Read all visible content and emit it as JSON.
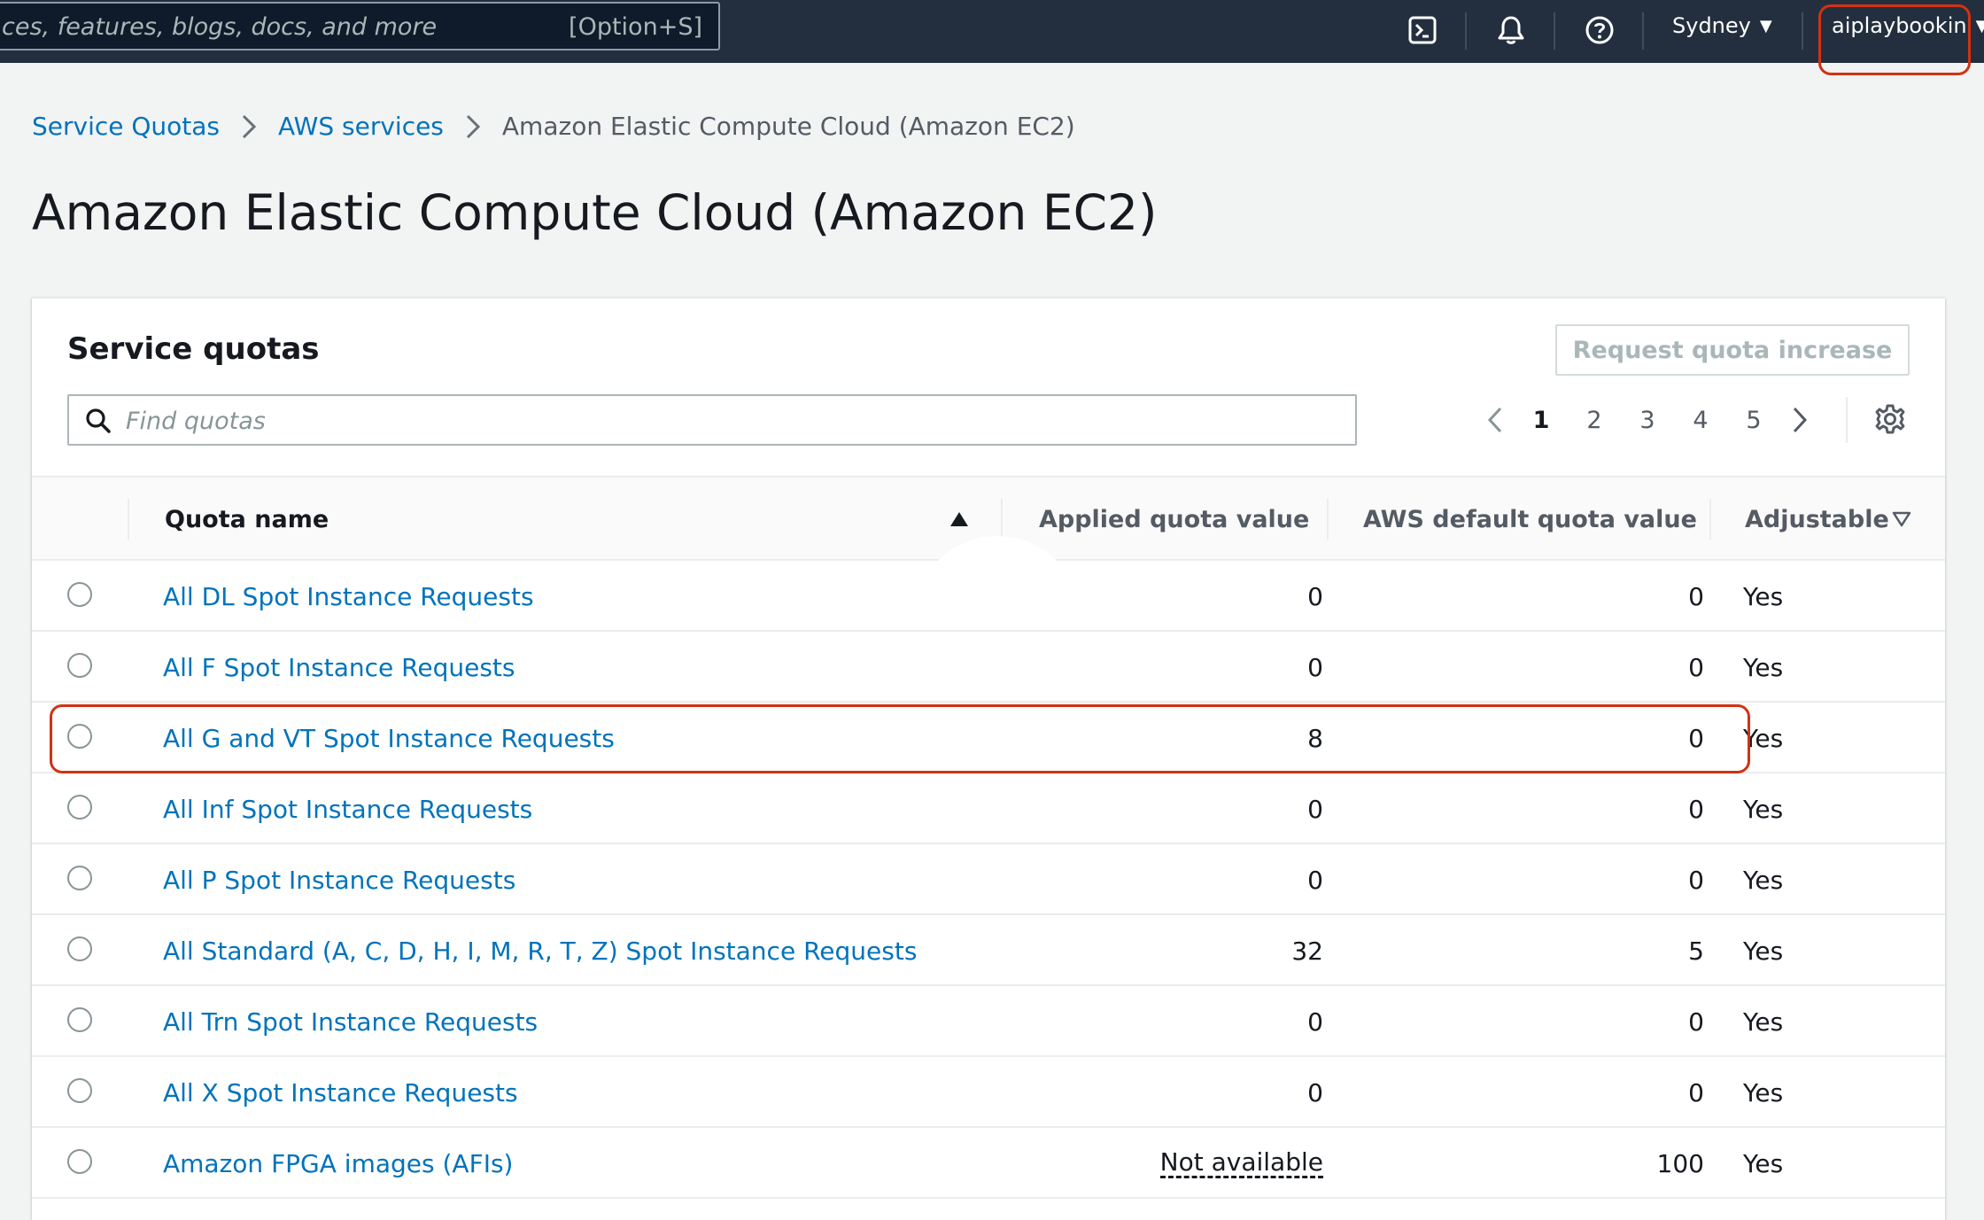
{
  "topbar": {
    "search_placeholder": "ces, features, blogs, docs, and more",
    "search_shortcut": "[Option+S]",
    "region": "Sydney",
    "account": "aiplaybookin"
  },
  "breadcrumb": {
    "items": [
      "Service Quotas",
      "AWS services"
    ],
    "current": "Amazon Elastic Compute Cloud (Amazon EC2)"
  },
  "page": {
    "title": "Amazon Elastic Compute Cloud (Amazon EC2)"
  },
  "panel": {
    "title": "Service quotas",
    "request_button": "Request quota increase",
    "search_placeholder": "Find quotas",
    "pages": [
      "1",
      "2",
      "3",
      "4",
      "5"
    ],
    "current_page": "1"
  },
  "table": {
    "headers": {
      "name": "Quota name",
      "applied": "Applied quota value",
      "default": "AWS default quota value",
      "adjustable": "Adjustable"
    },
    "rows": [
      {
        "name": "All DL Spot Instance Requests",
        "applied": "0",
        "default": "0",
        "adjustable": "Yes"
      },
      {
        "name": "All F Spot Instance Requests",
        "applied": "0",
        "default": "0",
        "adjustable": "Yes"
      },
      {
        "name": "All G and VT Spot Instance Requests",
        "applied": "8",
        "default": "0",
        "adjustable": "Yes"
      },
      {
        "name": "All Inf Spot Instance Requests",
        "applied": "0",
        "default": "0",
        "adjustable": "Yes"
      },
      {
        "name": "All P Spot Instance Requests",
        "applied": "0",
        "default": "0",
        "adjustable": "Yes"
      },
      {
        "name": "All Standard (A, C, D, H, I, M, R, T, Z) Spot Instance Requests",
        "applied": "32",
        "default": "5",
        "adjustable": "Yes"
      },
      {
        "name": "All Trn Spot Instance Requests",
        "applied": "0",
        "default": "0",
        "adjustable": "Yes"
      },
      {
        "name": "All X Spot Instance Requests",
        "applied": "0",
        "default": "0",
        "adjustable": "Yes"
      },
      {
        "name": "Amazon FPGA images (AFIs)",
        "applied": "Not available",
        "default": "100",
        "adjustable": "Yes"
      }
    ]
  },
  "colors": {
    "nav_bg": "#232f3e",
    "link": "#0073bb",
    "highlight": "#d13212"
  }
}
